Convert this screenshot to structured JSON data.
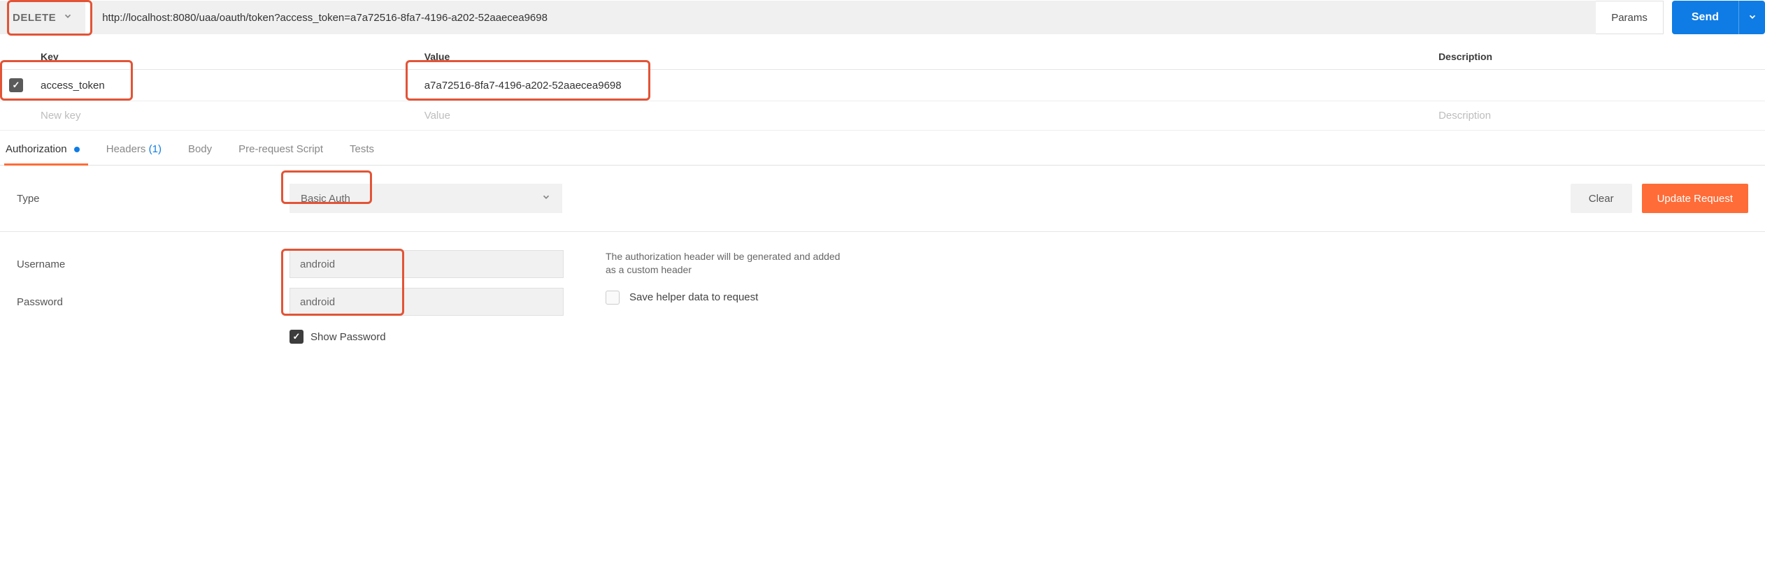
{
  "request": {
    "method": "DELETE",
    "url": "http://localhost:8080/uaa/oauth/token?access_token=a7a72516-8fa7-4196-a202-52aaecea9698",
    "params_button": "Params",
    "send_button": "Send"
  },
  "params_table": {
    "headers": {
      "key": "Key",
      "value": "Value",
      "description": "Description"
    },
    "rows": [
      {
        "checked": true,
        "key": "access_token",
        "value": "a7a72516-8fa7-4196-a202-52aaecea9698",
        "description": ""
      }
    ],
    "placeholder_row": {
      "key": "New key",
      "value": "Value",
      "description": "Description"
    }
  },
  "tabs": {
    "authorization": "Authorization",
    "headers": "Headers",
    "headers_count": "(1)",
    "body": "Body",
    "prerequest": "Pre-request Script",
    "tests": "Tests"
  },
  "auth": {
    "type_label": "Type",
    "type_value": "Basic Auth",
    "clear_button": "Clear",
    "update_button": "Update Request",
    "username_label": "Username",
    "username_value": "android",
    "password_label": "Password",
    "password_value": "android",
    "show_password_label": "Show Password",
    "helper_text": "The authorization header will be generated and added as a custom header",
    "save_helper_label": "Save helper data to request"
  }
}
